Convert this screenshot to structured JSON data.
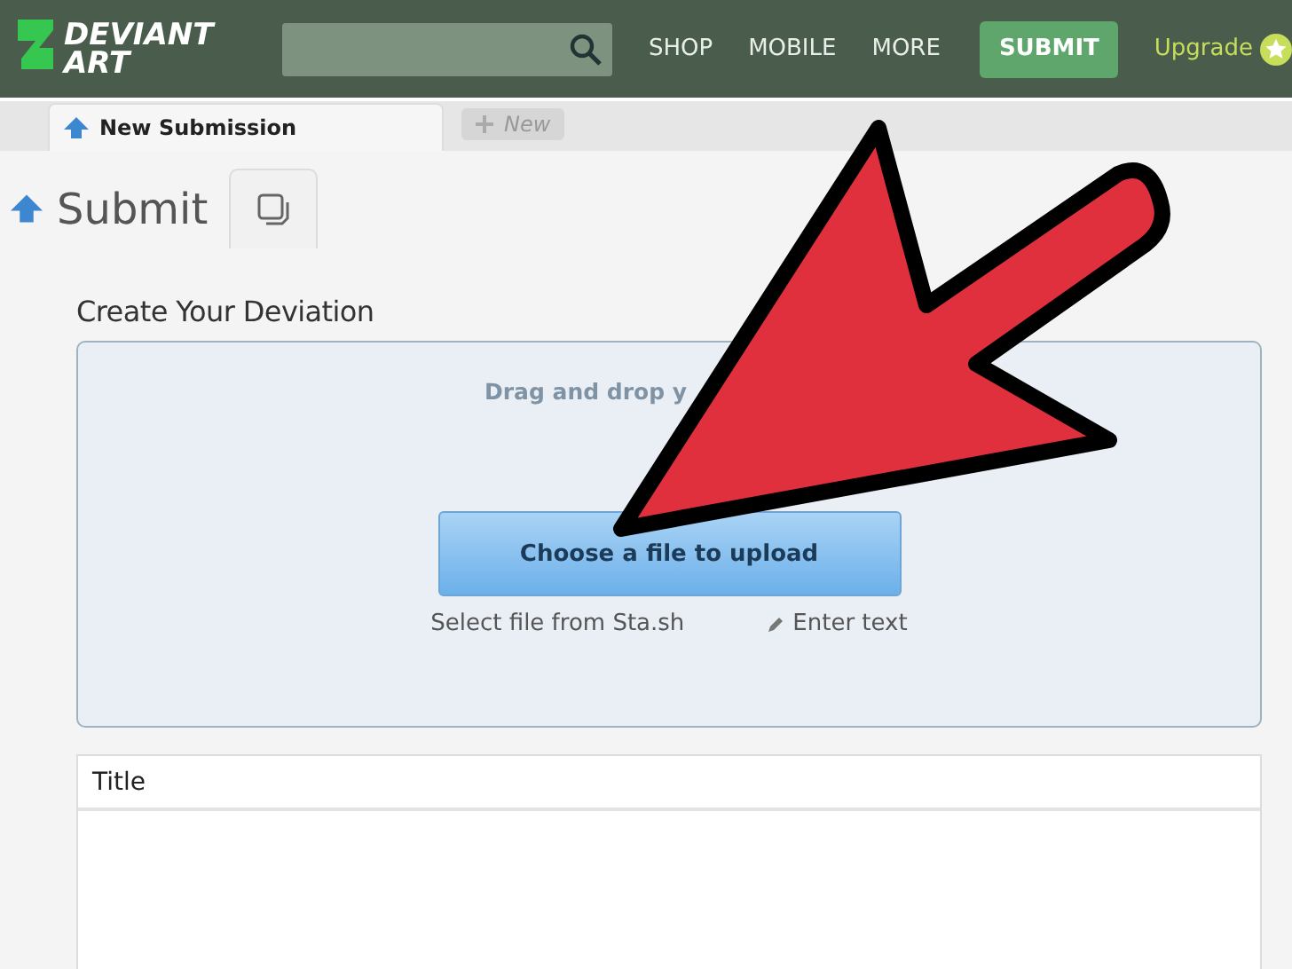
{
  "header": {
    "logo": [
      "DEVIANT",
      "ART"
    ],
    "nav": [
      "SHOP",
      "MOBILE",
      "MORE"
    ],
    "submit_button": "SUBMIT",
    "upgrade": "Upgrade"
  },
  "tabs": [
    {
      "label": "New Submission",
      "selected": true
    },
    {
      "label": "New",
      "selected": false
    }
  ],
  "page_title": "Submit",
  "section_title": "Create Your Deviation",
  "dropzone": {
    "hint": "Drag and drop y",
    "button": "Choose a file to upload",
    "links": [
      {
        "kind": "plain",
        "label": "Select file from Sta.sh"
      },
      {
        "kind": "pencil",
        "label": "Enter text"
      }
    ]
  },
  "title_field": {
    "label": "Title"
  }
}
